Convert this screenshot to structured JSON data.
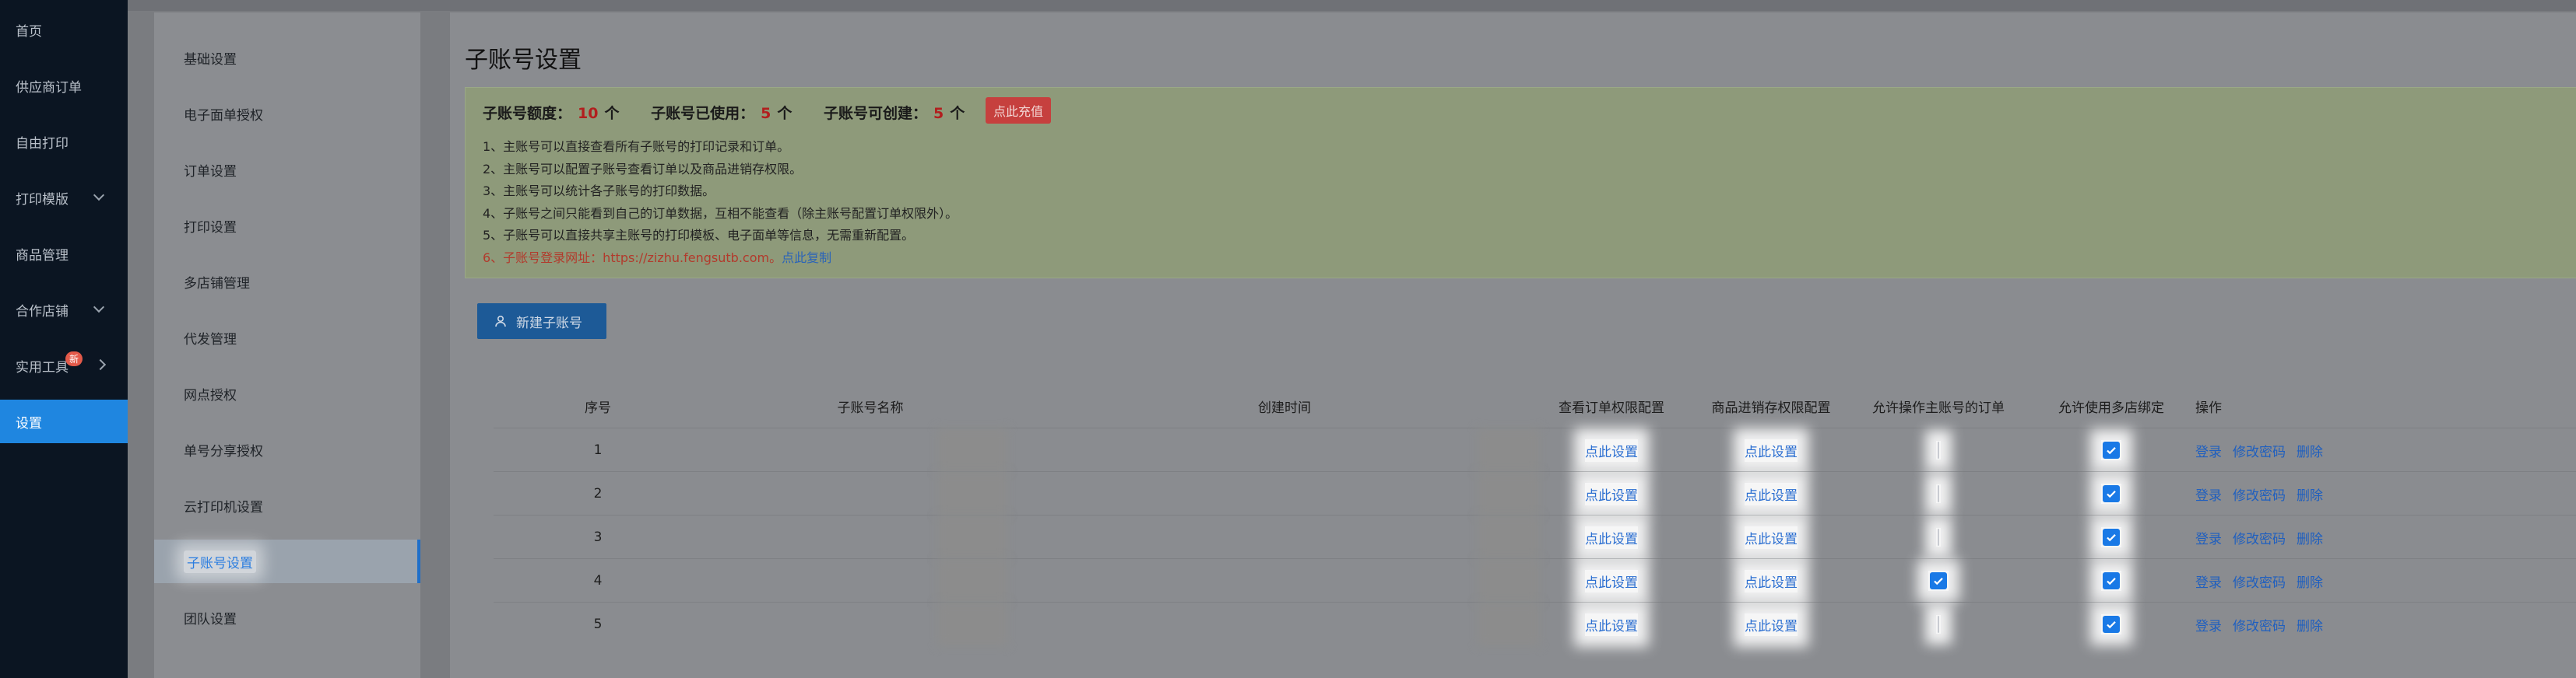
{
  "nav": {
    "items": [
      {
        "label": "首页"
      },
      {
        "label": "供应商订单"
      },
      {
        "label": "自由打印"
      },
      {
        "label": "打印模版"
      },
      {
        "label": "商品管理"
      },
      {
        "label": "合作店铺"
      },
      {
        "label": "实用工具"
      },
      {
        "label": "设置"
      }
    ],
    "badge_new": "新"
  },
  "settings_menu": [
    "基础设置",
    "电子面单授权",
    "订单设置",
    "打印设置",
    "多店铺管理",
    "代发管理",
    "网点授权",
    "单号分享授权",
    "云打印机设置",
    "子账号设置",
    "团队设置"
  ],
  "page_title": "子账号设置",
  "quota": {
    "label_total": "子账号额度：",
    "total": "10",
    "unit": "个",
    "label_used": "子账号已使用：",
    "used": "5",
    "label_avail": "子账号可创建：",
    "avail": "5",
    "recharge": "点此充值"
  },
  "tips": [
    "1、主账号可以直接查看所有子账号的打印记录和订单。",
    "2、主账号可以配置子账号查看订单以及商品进销存权限。",
    "3、主账号可以统计各子账号的打印数据。",
    "4、子账号之间只能看到自己的订单数据，互相不能查看（除主账号配置订单权限外）。",
    "5、子账号可以直接共享主账号的打印模板、电子面单等信息，无需重新配置。"
  ],
  "tip6_prefix": "6、子账号登录网址：https://zizhu.fengsutb.com。",
  "tip6_link": "点此复制",
  "create_button": "新建子账号",
  "table": {
    "headers": {
      "no": "序号",
      "name": "子账号名称",
      "created": "创建时间",
      "order_perm": "查看订单权限配置",
      "inv_perm": "商品进销存权限配置",
      "allow_main": "允许操作主账号的订单",
      "allow_multi": "允许使用多店绑定",
      "ops": "操作"
    },
    "rows": [
      {
        "no": "1",
        "order": "点此设置",
        "inv": "点此设置",
        "allow_main": false,
        "allow_multi": true
      },
      {
        "no": "2",
        "order": "点此设置",
        "inv": "点此设置",
        "allow_main": false,
        "allow_multi": true
      },
      {
        "no": "3",
        "order": "点此设置",
        "inv": "点此设置",
        "allow_main": false,
        "allow_multi": true
      },
      {
        "no": "4",
        "order": "点此设置",
        "inv": "点此设置",
        "allow_main": true,
        "allow_multi": true
      },
      {
        "no": "5",
        "order": "点此设置",
        "inv": "点此设置",
        "allow_main": false,
        "allow_multi": true
      }
    ],
    "ops": {
      "login": "登录",
      "change_pwd": "修改密码",
      "delete": "删除"
    }
  },
  "colors": {
    "accent": "#1f86e0",
    "danger": "#c6403e",
    "link": "#2c6fd1"
  }
}
